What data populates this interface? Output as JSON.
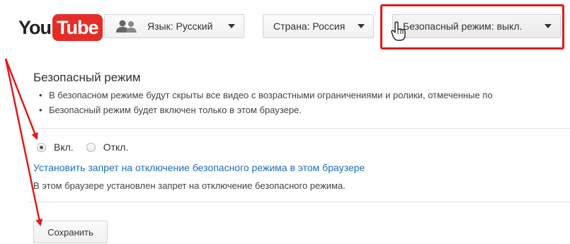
{
  "header": {
    "logo": {
      "you": "You",
      "tube": "Tube"
    },
    "language": {
      "label": "Язык: Русский",
      "icon": "people-icon"
    },
    "country": {
      "label": "Страна: Россия"
    },
    "safe_mode": {
      "label": "Безопасный режим: выкл."
    }
  },
  "section": {
    "title": "Безопасный режим",
    "bullets": [
      "В безопасном режиме будут скрыты все видео с возрастными ограничениями и ролики, отмеченные по",
      "Безопасный режим будет включен только в этом браузере."
    ],
    "radios": [
      {
        "label": "Вкл.",
        "checked": true
      },
      {
        "label": "Откл.",
        "checked": false
      }
    ],
    "lock_link": "Установить запрет на отключение безопасного режима в этом браузере",
    "lock_note": "В этом браузере установлен запрет на отключение безопасного режима.",
    "save_label": "Сохранить"
  },
  "colors": {
    "annotation_red": "#e01b1b",
    "link_blue": "#1e6db8",
    "youtube_red": "#e52d27"
  }
}
